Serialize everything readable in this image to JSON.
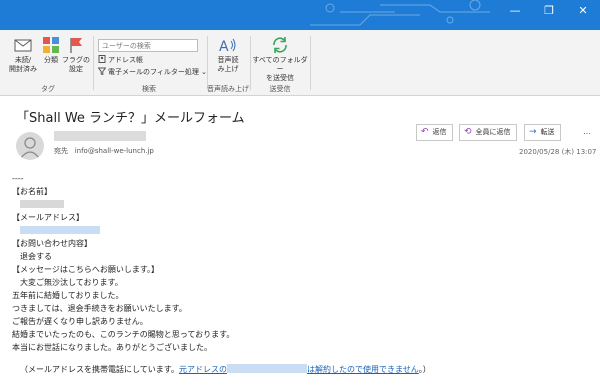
{
  "titlebar": {
    "min_icon": "minimize-icon",
    "max_icon": "maximize-icon",
    "close_icon": "close-icon",
    "min_glyph": "—",
    "max_glyph": "❐",
    "close_glyph": "✕"
  },
  "ribbon": {
    "tag_group": {
      "label": "タグ",
      "unread_label_1": "未読/",
      "unread_label_2": "開封済み",
      "categorize_label": "分類",
      "flag_label_1": "フラグの",
      "flag_label_2": "設定"
    },
    "search_group": {
      "label": "検索",
      "search_placeholder": "ユーザーの検索",
      "address_book": "アドレス帳",
      "filter_email": "電子メールのフィルター処理"
    },
    "speech_group": {
      "label": "音声読み上げ",
      "read_aloud_1": "音声読",
      "read_aloud_2": "み上げ"
    },
    "sendrecv_group": {
      "label": "送受信",
      "sendrecv_1": "すべてのフォルダー",
      "sendrecv_2": "を送受信"
    }
  },
  "message": {
    "subject": "「Shall We ランチ？」メールフォーム",
    "to_label": "宛先",
    "to_address": "info@shall-we-lunch.jp",
    "timestamp": "2020/05/28 (木) 13:07",
    "actions": {
      "reply": "返信",
      "reply_all": "全員に返信",
      "forward": "転送",
      "more": "…"
    }
  },
  "body": {
    "sep": "----",
    "name_label": "【お名前】",
    "email_label": "【メールアドレス】",
    "inquiry_label": "【お問い合わせ内容】",
    "inquiry_value": "退会する",
    "message_label": "【メッセージはこちらへお願いします。】",
    "lines": [
      "大変ご無沙汰しております。",
      "五年前に結婚しておりました。",
      "つきましては、退会手続きをお願いいたします。",
      "ご報告が遅くなり申し訳ありません。",
      "結婚までいたったのも、このランチの賜物と思っております。",
      "本当にお世話になりました。ありがとうございました。"
    ],
    "footer_prefix": "（メールアドレスを携帯電話にしています。",
    "footer_link_start": "元アドレスの",
    "footer_link_end": "は解約したので使用できません",
    "footer_suffix": "。）"
  },
  "colors": {
    "titlebar": "#1e7cd6",
    "link": "#1a63b8",
    "ribbon_bg": "#f3f3f3"
  }
}
